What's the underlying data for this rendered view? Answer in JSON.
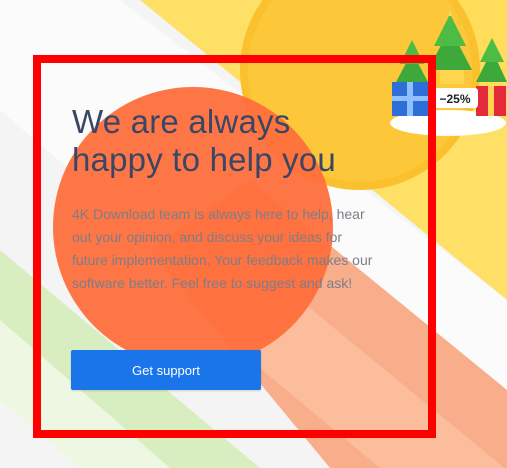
{
  "hero": {
    "title_line1": "We are always",
    "title_line2": "happy to help you",
    "description": "4K Download team is always here to help, hear out your opinion, and discuss your ideas for future implementation. Your feedback makes our software better. Feel free to suggest and ask!",
    "cta_label": "Get support"
  },
  "promo": {
    "discount_label": "−25%"
  },
  "colors": {
    "accent_button": "#1a75ea",
    "title_text": "#3a4666",
    "body_text": "#7d7d88",
    "highlight_frame": "#ff0000",
    "orange_circle": "#ff6a35",
    "yellow_band": "#ffd84f",
    "salmon_band": "#f6a07a",
    "green_band": "#d7ecb8"
  }
}
